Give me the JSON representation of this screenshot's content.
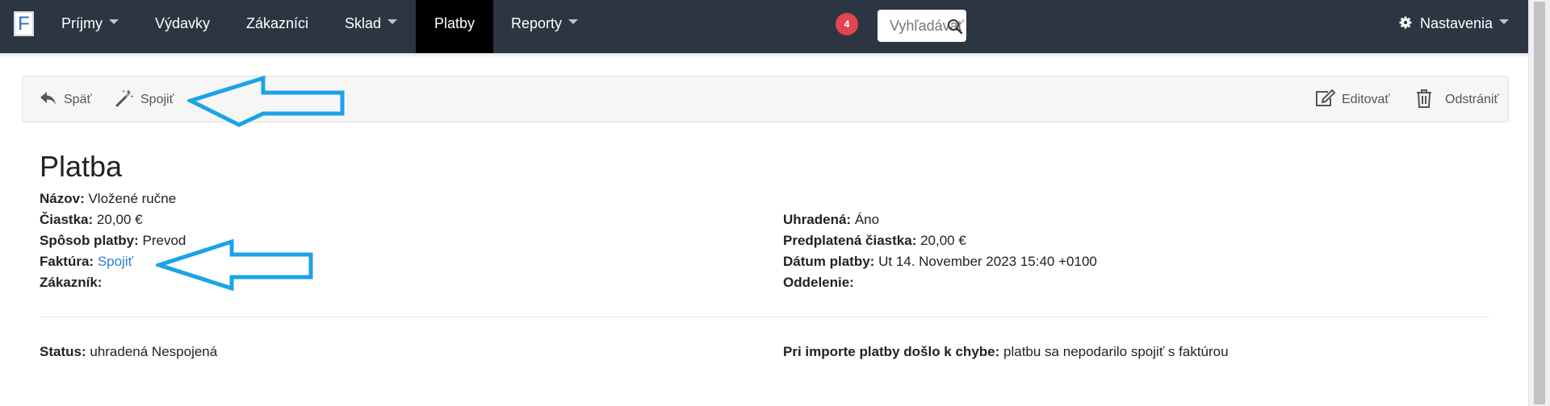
{
  "navbar": {
    "logo_letter": "F",
    "items": [
      {
        "label": "Príjmy",
        "dropdown": true
      },
      {
        "label": "Výdavky",
        "dropdown": false
      },
      {
        "label": "Zákazníci",
        "dropdown": false
      },
      {
        "label": "Sklad",
        "dropdown": true
      },
      {
        "label": "Platby",
        "dropdown": false,
        "active": true
      },
      {
        "label": "Reporty",
        "dropdown": true
      }
    ],
    "notification_count": "4",
    "search_placeholder": "Vyhľadávať",
    "settings_label": "Nastavenia",
    "settings_icon": "gear-icon"
  },
  "toolbar": {
    "back_label": "Späť",
    "back_icon": "reply-arrow-icon",
    "connect_label": "Spojiť",
    "connect_icon": "magic-wand-icon",
    "edit_label": "Editovať",
    "edit_icon": "edit-icon",
    "delete_label": "Odstrániť",
    "delete_icon": "trash-icon"
  },
  "payment": {
    "title": "Platba",
    "left": [
      {
        "label": "Názov:",
        "value": "Vložené ručne"
      },
      {
        "label": "Čiastka:",
        "value": "20,00 €"
      },
      {
        "label": "Spôsob platby:",
        "value": "Prevod"
      },
      {
        "label": "Faktúra:",
        "value": "Spojiť",
        "link": true
      },
      {
        "label": "Zákazník:",
        "value": ""
      }
    ],
    "right": [
      {
        "label": "Uhradená:",
        "value": "Áno"
      },
      {
        "label": "Predplatená čiastka:",
        "value": "20,00 €"
      },
      {
        "label": "Dátum platby:",
        "value": "Ut 14. November 2023 15:40 +0100"
      },
      {
        "label": "Oddelenie:",
        "value": ""
      }
    ],
    "status_label": "Status:",
    "status_value": "uhradená Nespojená",
    "error_label": "Pri importe platby došlo k chybe:",
    "error_value": "platbu sa nepodarilo spojiť s faktúrou"
  },
  "colors": {
    "navbar_bg": "#2c3542",
    "active_tab_bg": "#000000",
    "badge": "#e04550",
    "link": "#2a7fd1",
    "annotation_arrow": "#1aa3e8"
  }
}
